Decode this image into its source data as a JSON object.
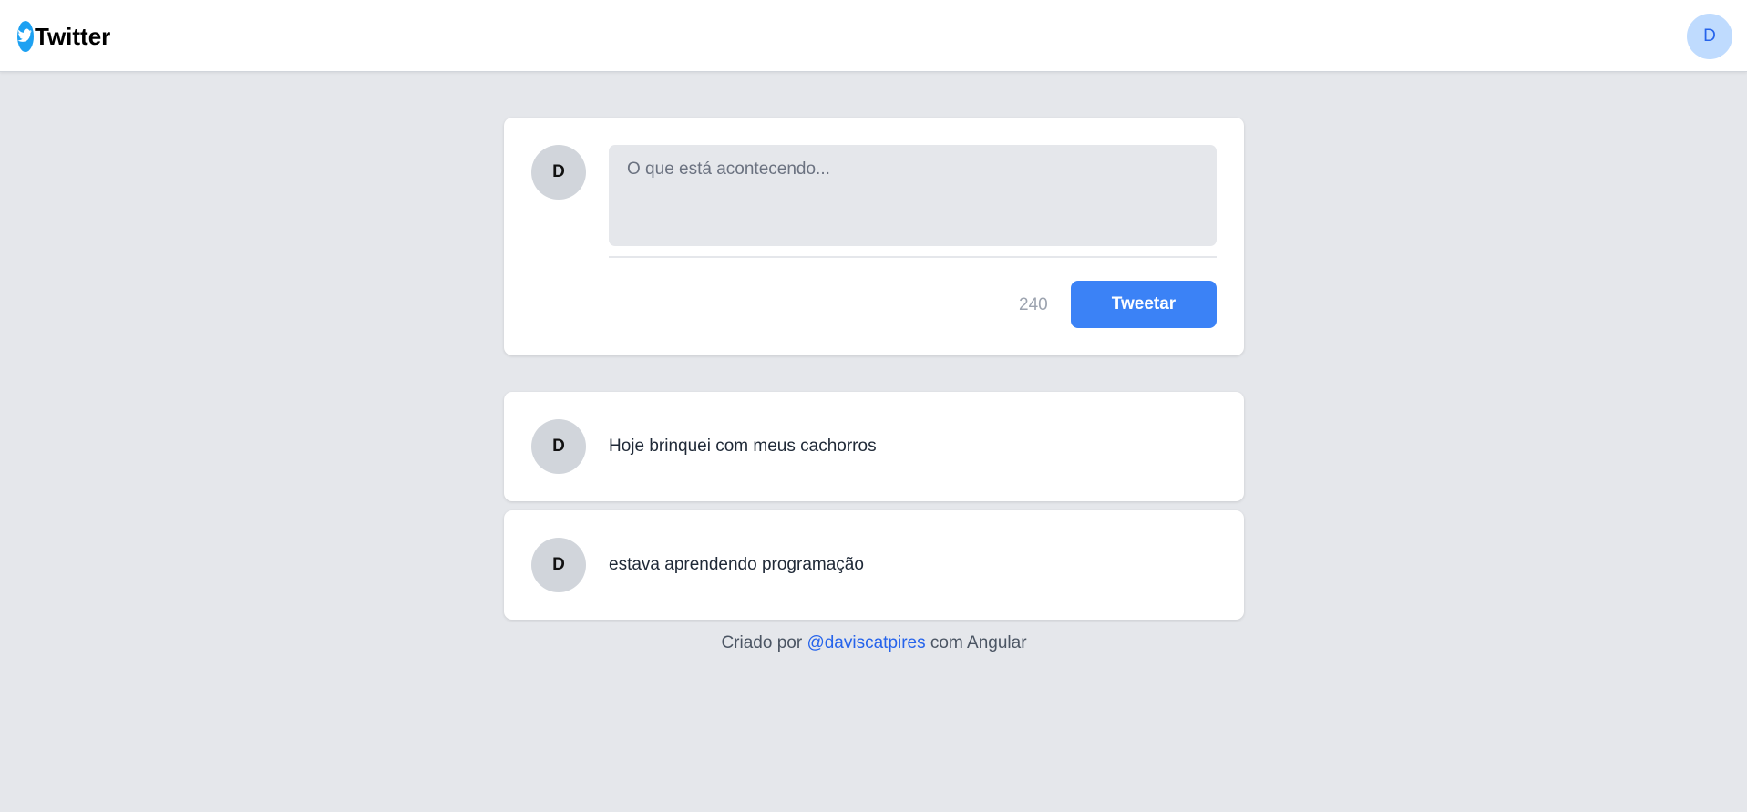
{
  "header": {
    "brand_name": "Twitter",
    "user_initial": "D"
  },
  "composer": {
    "avatar_initial": "D",
    "placeholder": "O que está acontecendo...",
    "char_count": "240",
    "submit_label": "Tweetar"
  },
  "tweets": [
    {
      "avatar_initial": "D",
      "text": "Hoje brinquei com meus cachorros"
    },
    {
      "avatar_initial": "D",
      "text": "estava aprendendo programação"
    }
  ],
  "footer": {
    "prefix": "Criado por",
    "author_link": "@daviscatpires",
    "suffix": "com Angular"
  },
  "colors": {
    "accent": "#3b82f6",
    "link": "#2563eb",
    "background": "#e5e7eb",
    "brand_icon": "#1da1f2"
  },
  "icons": {
    "brand": "twitter-bird-icon"
  }
}
